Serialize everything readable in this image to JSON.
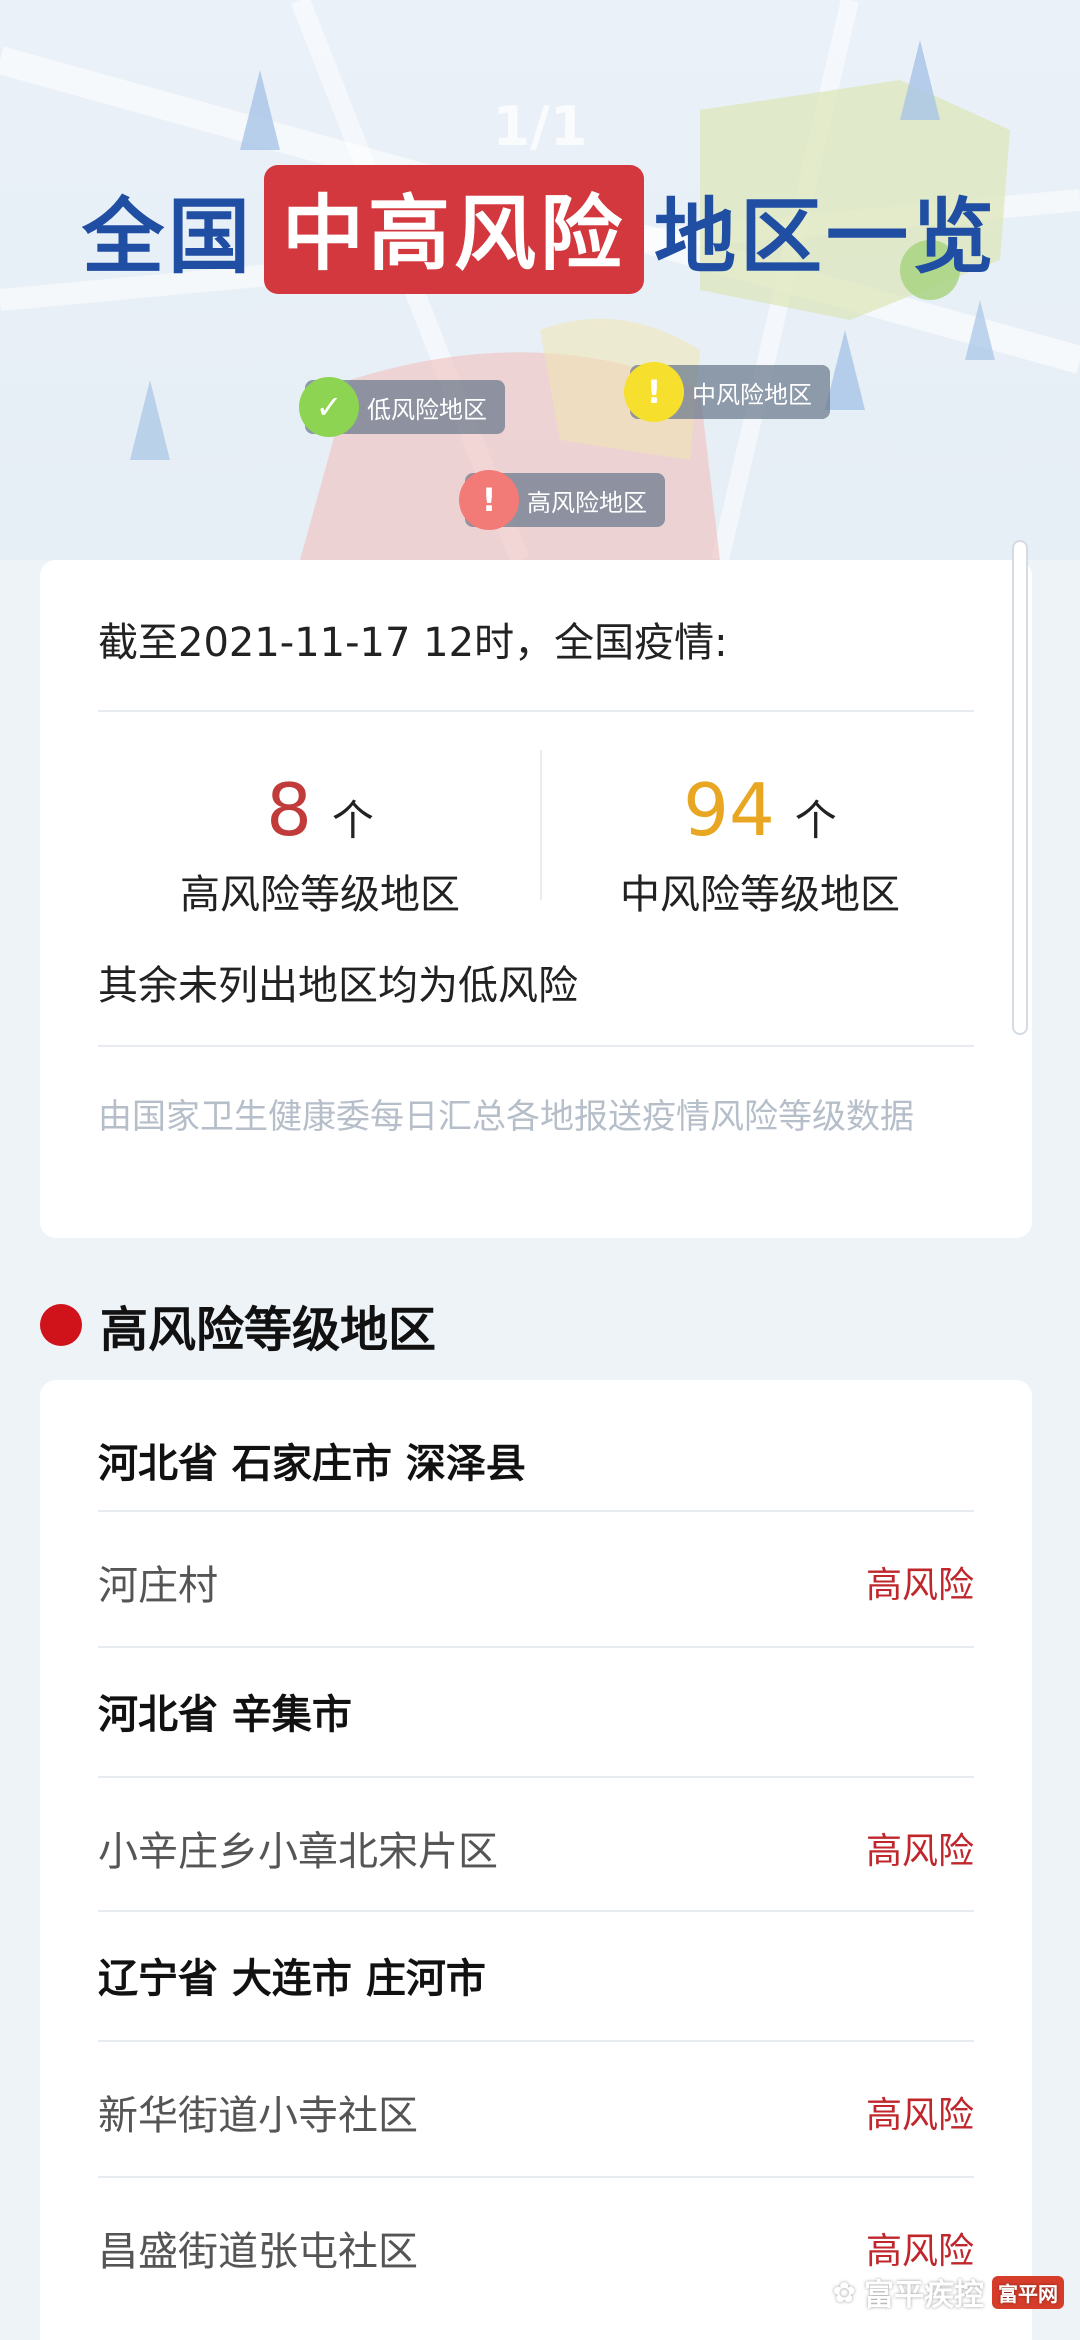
{
  "hero": {
    "page_indicator": "1/1",
    "title_prefix": "全国",
    "title_highlight": "中高风险",
    "title_suffix": "地区一览",
    "legend": [
      {
        "label": "低风险地区",
        "color": "#8cd451",
        "symbol": "✓"
      },
      {
        "label": "中风险地区",
        "color": "#f7df2d",
        "symbol": "!"
      },
      {
        "label": "高风险地区",
        "color": "#f27a77",
        "symbol": "!"
      }
    ]
  },
  "summary": {
    "date_line": "截至2021-11-17 12时，全国疫情:",
    "high": {
      "count": "8",
      "unit": "个",
      "label": "高风险等级地区",
      "color": "#c23b3b"
    },
    "medium": {
      "count": "94",
      "unit": "个",
      "label": "中风险等级地区",
      "color": "#e8a623"
    },
    "note": "其余未列出地区均为低风险",
    "source": "由国家卫生健康委每日汇总各地报送疫情风险等级数据"
  },
  "section": {
    "title": "高风险等级地区"
  },
  "list": {
    "badge": "高风险",
    "rows": [
      {
        "type": "region",
        "text": "河北省 石家庄市 深泽县"
      },
      {
        "type": "area",
        "text": "河庄村"
      },
      {
        "type": "region",
        "text": "河北省 辛集市"
      },
      {
        "type": "area",
        "text": "小辛庄乡小章北宋片区"
      },
      {
        "type": "region",
        "text": "辽宁省 大连市 庄河市"
      },
      {
        "type": "area",
        "text": "新华街道小寺社区"
      },
      {
        "type": "area",
        "text": "昌盛街道张屯社区"
      }
    ]
  },
  "watermark": {
    "text": "富平疾控",
    "logo_text": "富平网"
  }
}
